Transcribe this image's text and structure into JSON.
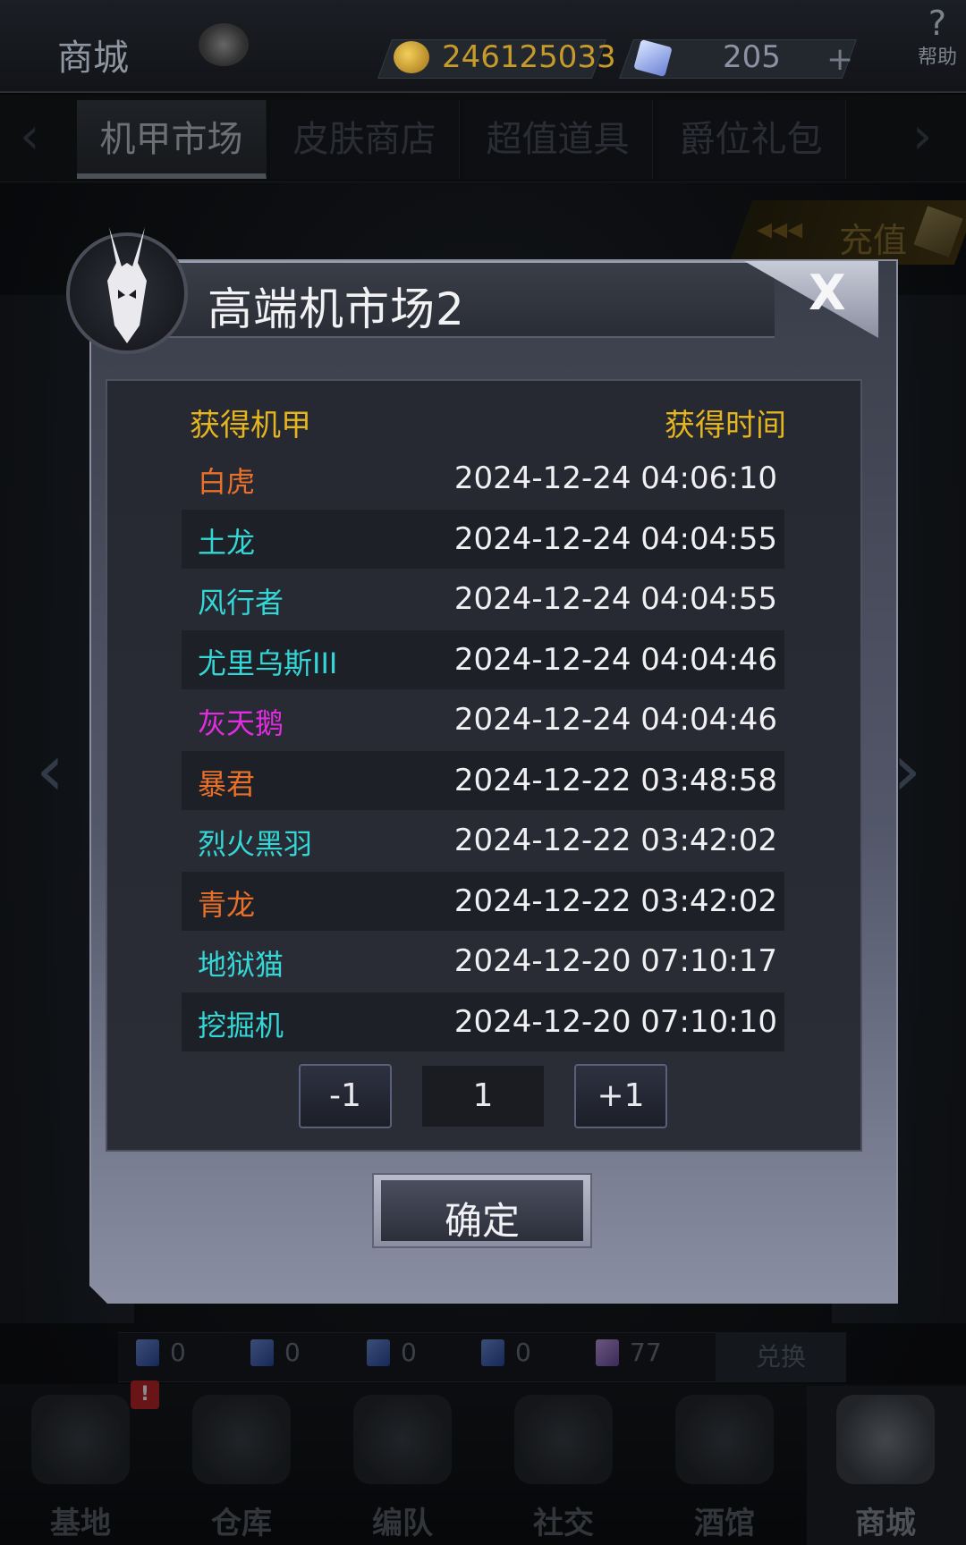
{
  "topbar": {
    "title": "商城",
    "gold": "246125033",
    "gems": "205",
    "help_label": "帮助"
  },
  "tabs": [
    "机甲市场",
    "皮肤商店",
    "超值道具",
    "爵位礼包"
  ],
  "recharge_label": "充值",
  "modal": {
    "title": "高端机市场2",
    "close_label": "X",
    "col_mecha": "获得机甲",
    "col_time": "获得时间",
    "rows": [
      {
        "name": "白虎",
        "time": "2024-12-24 04:06:10",
        "color": "#e8702a"
      },
      {
        "name": "土龙",
        "time": "2024-12-24 04:04:55",
        "color": "#34d6d6"
      },
      {
        "name": "风行者",
        "time": "2024-12-24 04:04:55",
        "color": "#34d6d6"
      },
      {
        "name": "尤里乌斯III",
        "time": "2024-12-24 04:04:46",
        "color": "#34d6d6"
      },
      {
        "name": "灰天鹅",
        "time": "2024-12-24 04:04:46",
        "color": "#e02de0"
      },
      {
        "name": "暴君",
        "time": "2024-12-22 03:48:58",
        "color": "#e8702a"
      },
      {
        "name": "烈火黑羽",
        "time": "2024-12-22 03:42:02",
        "color": "#34d6d6"
      },
      {
        "name": "青龙",
        "time": "2024-12-22 03:42:02",
        "color": "#e8702a"
      },
      {
        "name": "地狱猫",
        "time": "2024-12-20 07:10:17",
        "color": "#34d6d6"
      },
      {
        "name": "挖掘机",
        "time": "2024-12-20 07:10:10",
        "color": "#34d6d6"
      }
    ],
    "pager": {
      "minus": "-1",
      "value": "1",
      "plus": "+1"
    },
    "confirm_label": "确定"
  },
  "currency": {
    "items": [
      "0",
      "0",
      "0",
      "0",
      "77"
    ],
    "exchange_label": "兑换"
  },
  "nav": {
    "items": [
      "基地",
      "仓库",
      "编队",
      "社交",
      "酒馆",
      "商城"
    ],
    "alert": "!"
  },
  "colors": {
    "header_gold": "#e5b520",
    "orange_rarity": "#e8702a",
    "cyan_rarity": "#34d6d6",
    "magenta_rarity": "#e02de0"
  }
}
